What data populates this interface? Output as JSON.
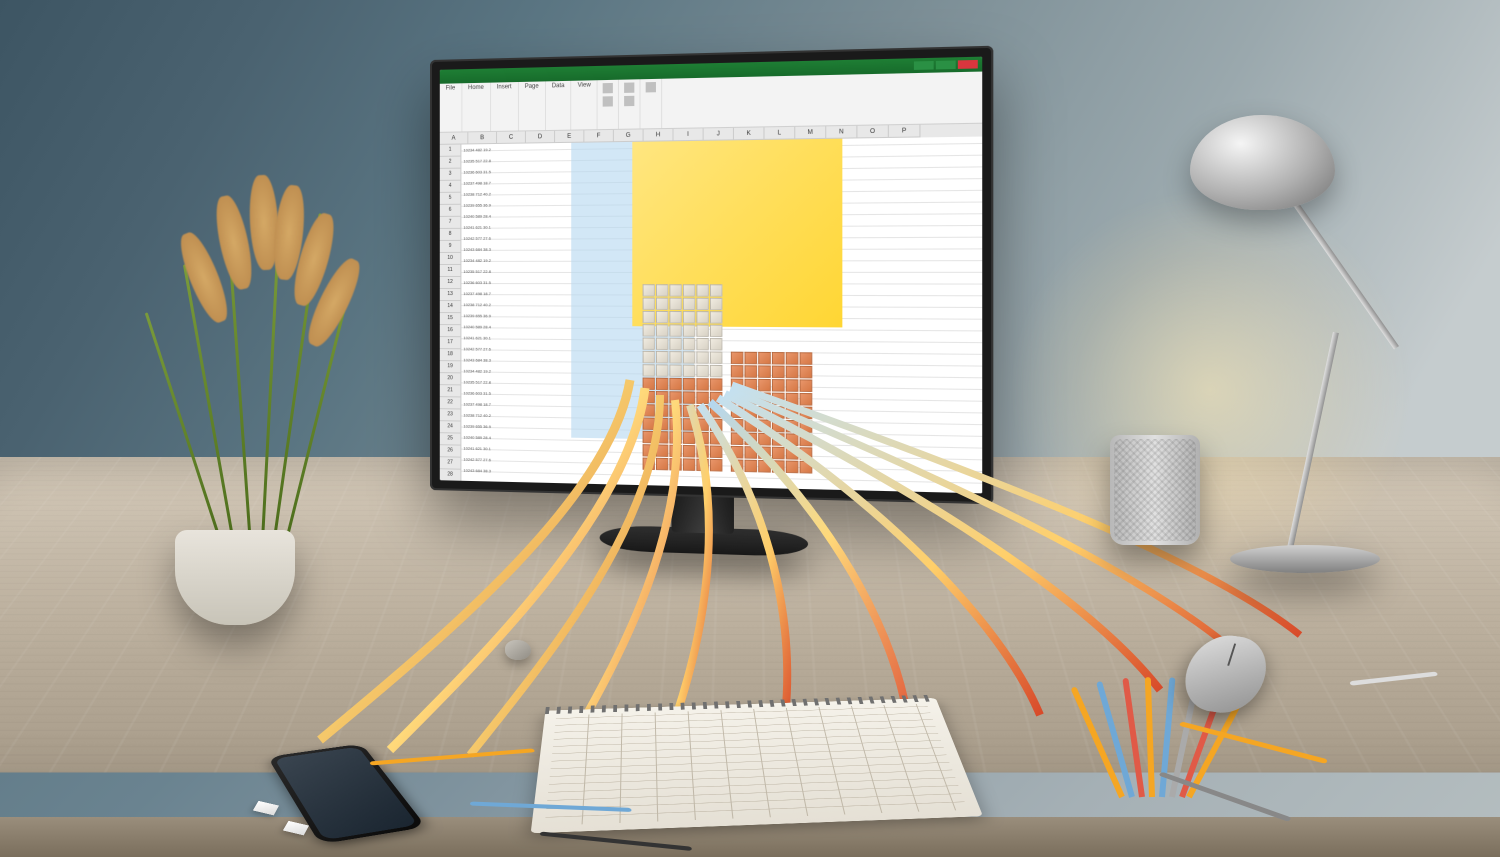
{
  "description": "Stylized 3D illustration of a desk workspace: a monitor showing a spreadsheet application with a 3D bar chart, colorful data strands flowing out of the screen onto a spiral notebook. Desk also holds a potted pampas-grass plant, desk lamp, pencil cup, mouse, smartphone, loose pencils, erasers and a small rock.",
  "objects": {
    "monitor": "computer-monitor",
    "app": "spreadsheet-application",
    "plant": "pampas-grass-in-pot",
    "lamp": "adjustable-desk-lamp",
    "cup": "mesh-pencil-cup",
    "notebook": "spiral-grid-notebook",
    "phone": "smartphone",
    "mouse": "computer-mouse"
  },
  "spreadsheet": {
    "tabs": [
      "File",
      "Home",
      "Insert",
      "Page",
      "Data",
      "View"
    ],
    "columns": [
      "A",
      "B",
      "C",
      "D",
      "E",
      "F",
      "G",
      "H",
      "I",
      "J",
      "K",
      "L",
      "M",
      "N",
      "O",
      "P"
    ],
    "row_count": 30,
    "sample_rows": [
      "10234  482  19.2",
      "10235  517  22.8",
      "10236  603  31.5",
      "10237  498  18.7",
      "10238  712  40.2",
      "10239  655  36.9",
      "10240  589  28.4",
      "10241  621  30.1",
      "10242  577  27.6",
      "10243  684  38.3"
    ]
  },
  "colors": {
    "excel_green": "#1e7e34",
    "highlight_yellow": "#ffd633",
    "highlight_blue": "#b4d7f0",
    "chart_orange": "#d67845",
    "pencil_yellow": "#f5a623",
    "pencil_blue": "#6fa8d6",
    "pencil_red": "#e05a47"
  }
}
